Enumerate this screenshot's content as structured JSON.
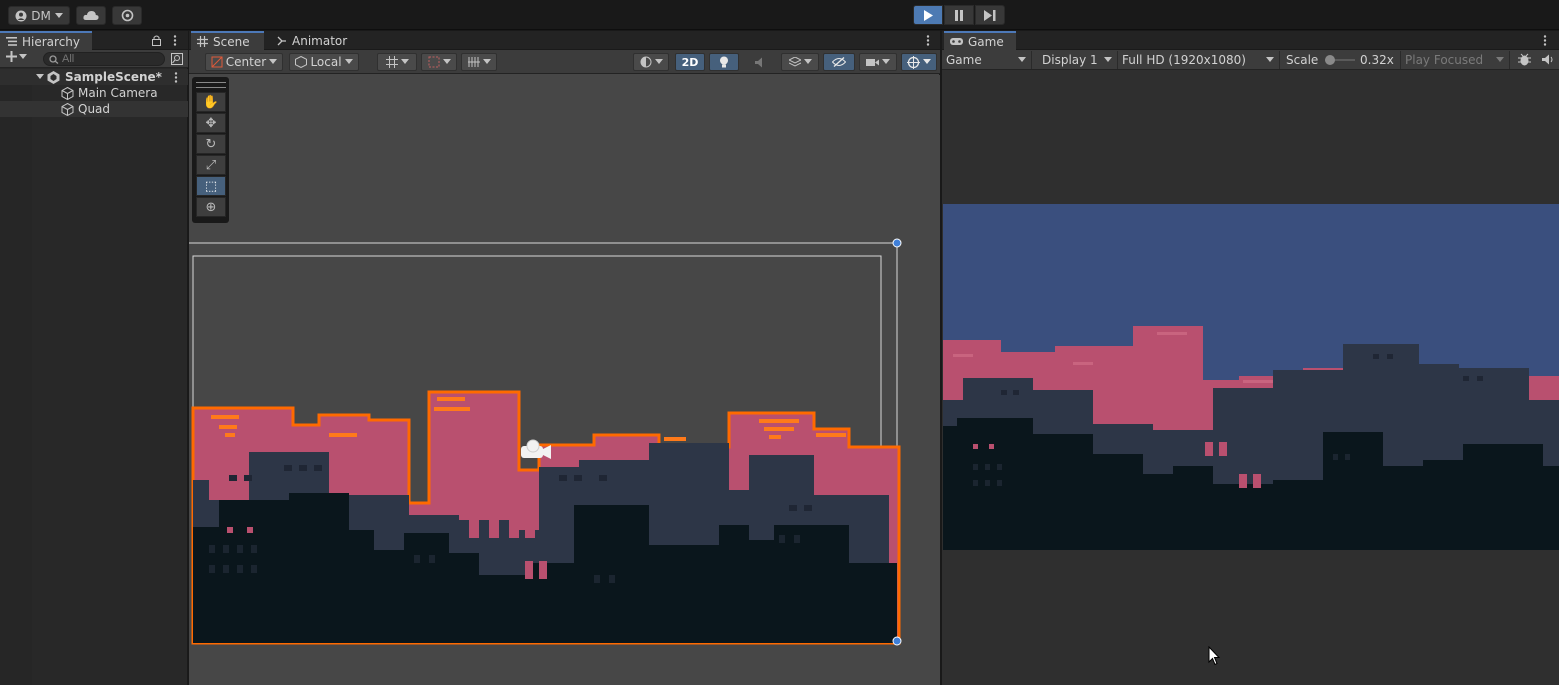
{
  "toolbar": {
    "account_label": "DM",
    "icons": [
      "account-icon",
      "cloud-icon",
      "settings-icon",
      "play-icon",
      "pause-icon",
      "step-icon"
    ]
  },
  "hierarchy": {
    "tab_label": "Hierarchy",
    "search_placeholder": "All",
    "items": [
      {
        "label": "SampleScene*",
        "kind": "scene"
      },
      {
        "label": "Main Camera",
        "kind": "gameobject"
      },
      {
        "label": "Quad",
        "kind": "gameobject"
      }
    ]
  },
  "scene": {
    "tab_label": "Scene",
    "animator_tab_label": "Animator",
    "pivot_label": "Center",
    "space_label": "Local",
    "mode_2d_label": "2D"
  },
  "game": {
    "tab_label": "Game",
    "view_mode": "Game",
    "display": "Display 1",
    "resolution": "Full HD (1920x1080)",
    "scale_label": "Scale",
    "scale_value": "0.32x",
    "play_mode": "Play Focused"
  },
  "colors": {
    "accent": "#4d7ab3",
    "selection_outline": "#ff6a00",
    "sky": "#3a4f7e",
    "building_pink": "#b9506f",
    "building_mid": "#2d3647",
    "building_dark": "#0a161c"
  }
}
